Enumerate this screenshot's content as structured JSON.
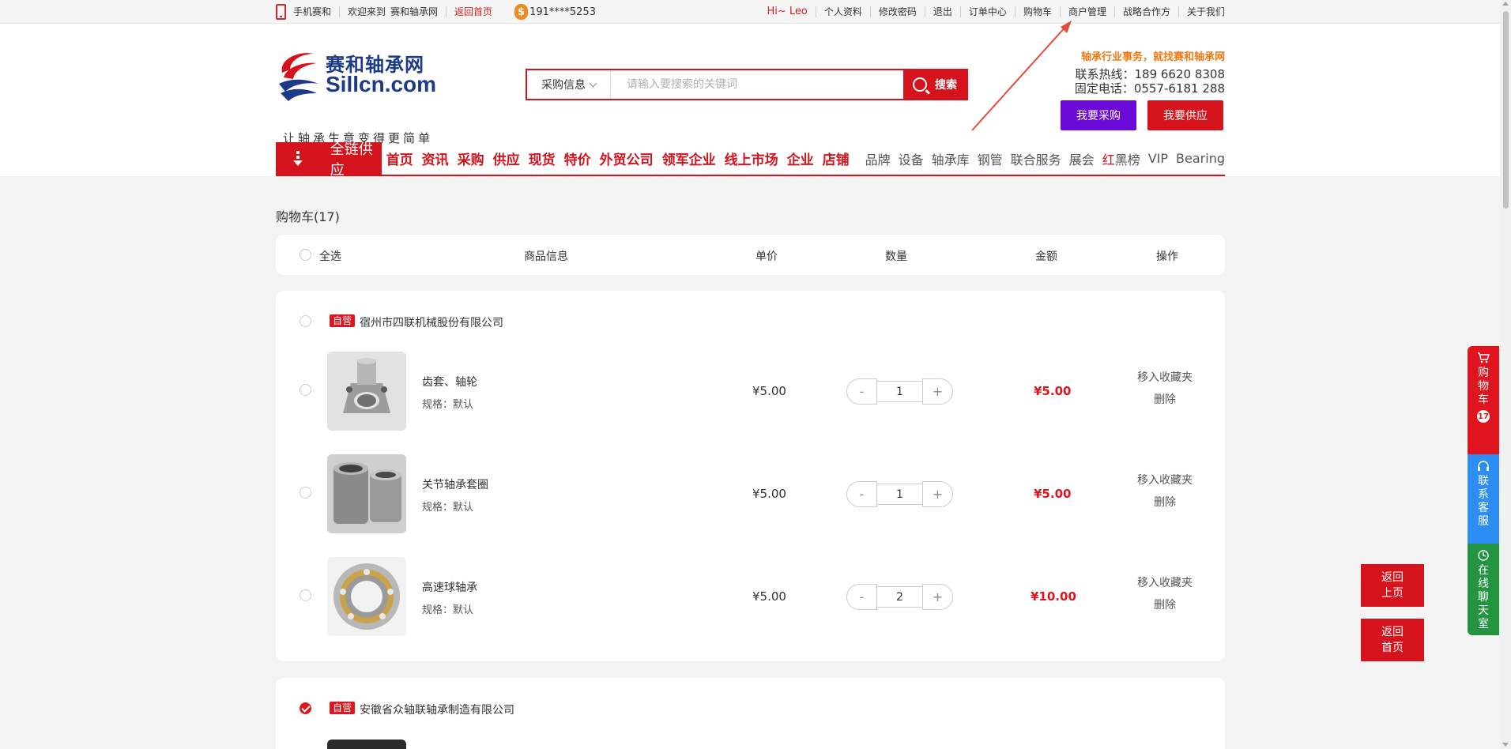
{
  "topbar": {
    "mobile": "手机赛和",
    "welcome": "欢迎来到",
    "site_name": "赛和轴承网",
    "back_home": "返回首页",
    "coin_symbol": "$",
    "phone": "191****5253",
    "greeting": "Hi~ Leo",
    "links": [
      "个人资料",
      "修改密码",
      "退出",
      "订单中心",
      "购物车",
      "商户管理",
      "战略合作方",
      "关于我们"
    ]
  },
  "header": {
    "logo_cn": "赛和轴承网",
    "logo_en": "Sillcn.com",
    "logo_slogan": "让轴承生意变得更简单",
    "search_type": "采购信息",
    "search_placeholder": "请输入要搜索的关键词",
    "search_button": "搜索",
    "slogan": "轴承行业事务，就找赛和轴承网",
    "hotline": "联系热线：189 6620 8308",
    "landline": "固定电话：0557-6181 288",
    "btn_purchase": "我要采购",
    "btn_supply": "我要供应"
  },
  "nav": {
    "category": "全链供应",
    "main_items": [
      "首页",
      "资讯",
      "采购",
      "供应",
      "现货",
      "特价",
      "外贸公司",
      "领军企业",
      "线上市场",
      "企业",
      "店铺"
    ],
    "sub_items_pre": [
      "品牌",
      "设备",
      "轴承库",
      "钢管",
      "联合服务",
      "展会"
    ],
    "redblack_red": "红",
    "redblack_black": "黑榜",
    "sub_items_post": [
      "VIP",
      "Bearing"
    ]
  },
  "cart": {
    "title": "购物车(17)",
    "headers": {
      "select_all": "全选",
      "info": "商品信息",
      "unit_price": "单价",
      "quantity": "数量",
      "amount": "金额",
      "operation": "操作"
    },
    "stores": [
      {
        "badge": "自营",
        "name": "宿州市四联机械股份有限公司",
        "checked": false,
        "items": [
          {
            "name": "齿套、轴轮",
            "spec": "规格：默认",
            "price": "¥5.00",
            "qty": "1",
            "amount": "¥5.00",
            "fav": "移入收藏夹",
            "del": "删除"
          },
          {
            "name": "关节轴承套圈",
            "spec": "规格：默认",
            "price": "¥5.00",
            "qty": "1",
            "amount": "¥5.00",
            "fav": "移入收藏夹",
            "del": "删除"
          },
          {
            "name": "高速球轴承",
            "spec": "规格：默认",
            "price": "¥5.00",
            "qty": "2",
            "amount": "¥10.00",
            "fav": "移入收藏夹",
            "del": "删除"
          }
        ]
      },
      {
        "badge": "自营",
        "name": "安徽省众轴联轴承制造有限公司",
        "checked": true,
        "items": []
      }
    ],
    "qty_minus": "-",
    "qty_plus": "+"
  },
  "float_side": {
    "cart": "购物车",
    "cart_count": "17",
    "service": "联系客服",
    "chat": "在线聊天室"
  },
  "float_buttons": {
    "back_prev_1": "返回",
    "back_prev_2": "上页",
    "back_home_1": "返回",
    "back_home_2": "首页"
  },
  "colors": {
    "brand_red": "#d5131d",
    "purple": "#6b0ad8",
    "orange": "#f07a11",
    "blue": "#2c8df3",
    "green": "#239540"
  }
}
